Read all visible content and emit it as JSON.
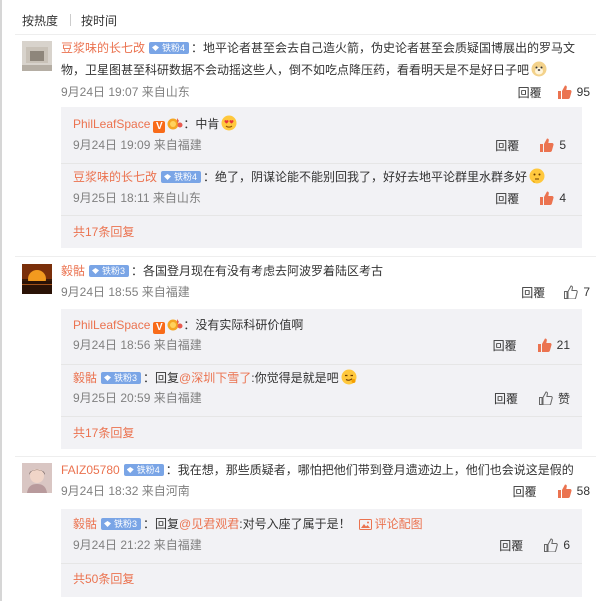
{
  "sort": {
    "hot": "按热度",
    "time": "按时间"
  },
  "common": {
    "reply": "回覆",
    "from": "来自"
  },
  "colors": {
    "accent": "#eb7350",
    "reply_bg": "#f2f2f5",
    "badge": "#7aa5e6"
  },
  "comments": [
    {
      "user": "豆浆味的长七改",
      "badge": "铁粉4",
      "text": "：地平论者甚至会去自己造火箭，伪史论者甚至会质疑国博展出的罗马文物，卫星图甚至科研数据不会动摇这些人，倒不如吃点降压药，看看明天是不是好日子吧",
      "date": "9月24日 19:07",
      "location": "来自山东",
      "likes": "95",
      "replies": [
        {
          "user": "PhilLeafSpace",
          "text": "：中肯",
          "date": "9月24日 19:09",
          "location": "来自福建",
          "likes": "5"
        },
        {
          "user": "豆浆味的长七改",
          "badge": "铁粉4",
          "text": "：绝了，阴谋论能不能别回我了，好好去地平论群里水群多好",
          "date": "9月25日 18:11",
          "location": "来自山东",
          "likes": "4"
        }
      ],
      "more": "共17条回复"
    },
    {
      "user": "毅骷",
      "badge": "铁粉3",
      "text": "：各国登月现在有没有考虑去阿波罗着陆区考古",
      "date": "9月24日 18:55",
      "location": "来自福建",
      "likes": "7",
      "replies": [
        {
          "user": "PhilLeafSpace",
          "text": "：没有实际科研价值啊",
          "date": "9月24日 18:56",
          "location": "来自福建",
          "likes": "21"
        },
        {
          "user": "毅骷",
          "badge": "铁粉3",
          "text_pre": "：回复",
          "mention": "@深圳下雪了",
          "text_post": ":你觉得是就是吧",
          "date": "9月25日 20:59",
          "location": "来自福建",
          "likes": "赞"
        }
      ],
      "more": "共17条回复"
    },
    {
      "user": "FAIZ05780",
      "badge": "铁粉4",
      "text": "：我在想，那些质疑者，哪怕把他们带到登月遗迹边上，他们也会说这是假的",
      "date": "9月24日 18:32",
      "location": "来自河南",
      "likes": "58",
      "replies": [
        {
          "user": "毅骷",
          "badge": "铁粉3",
          "text_pre": "：回复",
          "mention": "@见君观君",
          "text_post": ":对号入座了属于是！",
          "pic_link": "评论配图",
          "date": "9月24日 21:22",
          "location": "来自福建",
          "likes": "6"
        }
      ],
      "more": "共50条回复"
    }
  ]
}
